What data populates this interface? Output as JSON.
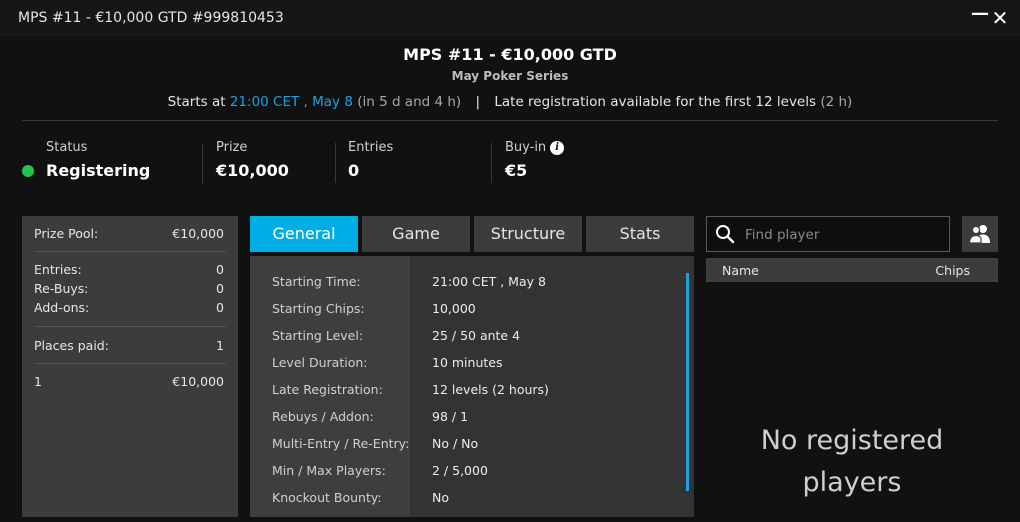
{
  "window": {
    "title": "MPS #11 - €10,000 GTD #999810453",
    "minimize_glyph": "—",
    "close_glyph": "✕"
  },
  "header": {
    "title": "MPS #11 - €10,000 GTD",
    "subtitle": "May Poker Series",
    "starts_prefix": "Starts at",
    "start_time": "21:00 CET , May 8",
    "countdown": "(in 5 d and 4 h)",
    "separator": "|",
    "late_reg_text": "Late registration available for the first 12 levels",
    "late_reg_duration": "(2 h)"
  },
  "stats": {
    "status": {
      "label": "Status",
      "value": "Registering",
      "dot_color": "#27c24c"
    },
    "prize": {
      "label": "Prize",
      "value": "€10,000"
    },
    "entries": {
      "label": "Entries",
      "value": "0"
    },
    "buyin": {
      "label": "Buy-in",
      "value": "€5",
      "icon": "info-icon"
    }
  },
  "prize_panel": {
    "pool_label": "Prize Pool:",
    "pool_value": "€10,000",
    "entries_label": "Entries:",
    "entries_value": "0",
    "rebuys_label": "Re-Buys:",
    "rebuys_value": "0",
    "addons_label": "Add-ons:",
    "addons_value": "0",
    "places_label": "Places paid:",
    "places_value": "1",
    "payouts": [
      {
        "place": "1",
        "amount": "€10,000"
      }
    ]
  },
  "tabs": [
    {
      "label": "General",
      "active": true
    },
    {
      "label": "Game",
      "active": false
    },
    {
      "label": "Structure",
      "active": false
    },
    {
      "label": "Stats",
      "active": false
    }
  ],
  "general": [
    {
      "label": "Starting Time:",
      "value": "21:00 CET , May 8"
    },
    {
      "label": "Starting Chips:",
      "value": "10,000"
    },
    {
      "label": "Starting Level:",
      "value": "25 / 50 ante 4"
    },
    {
      "label": "Level Duration:",
      "value": "10 minutes"
    },
    {
      "label": "Late Registration:",
      "value": "12 levels (2 hours)"
    },
    {
      "label": "Rebuys / Addon:",
      "value": "98 / 1"
    },
    {
      "label": "Multi-Entry / Re-Entry:",
      "value": "No / No"
    },
    {
      "label": "Min / Max Players:",
      "value": "2 / 5,000"
    },
    {
      "label": "Knockout Bounty:",
      "value": "No"
    }
  ],
  "players": {
    "search_placeholder": "Find player",
    "search_icon": "search-icon",
    "friends_icon": "friends-icon",
    "col_name": "Name",
    "col_chips": "Chips",
    "empty_line1": "No registered",
    "empty_line2": "players"
  },
  "colors": {
    "accent": "#00aee6",
    "link": "#1aa3e0",
    "status_green": "#27c24c"
  }
}
